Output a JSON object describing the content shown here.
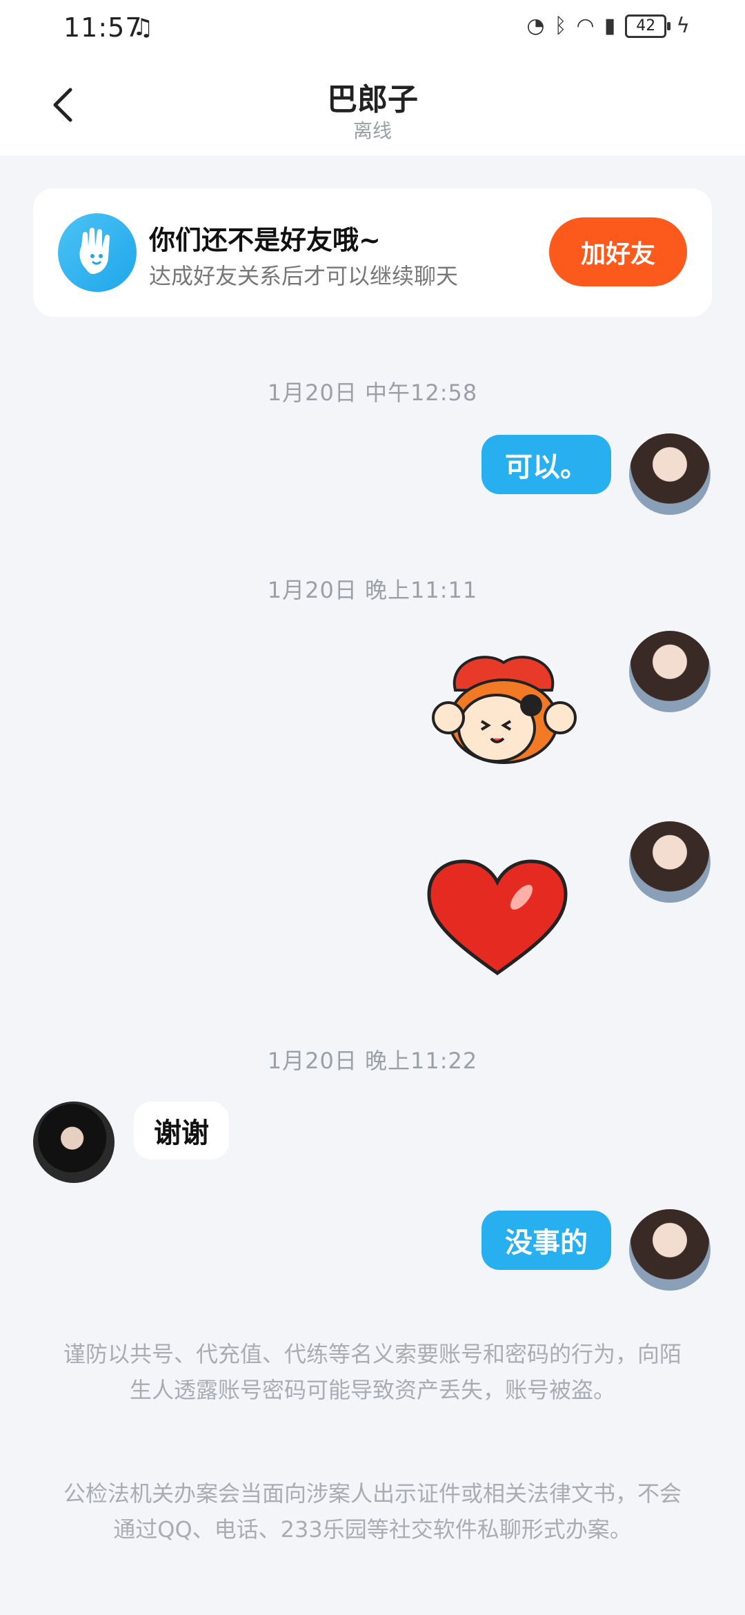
{
  "status_bar": {
    "time": "11:57",
    "icons": [
      "speed-icon",
      "bluetooth-icon",
      "wifi-icon",
      "alert-icon",
      "charging-icon"
    ],
    "battery": "42"
  },
  "header": {
    "title": "巴郎子",
    "status": "离线"
  },
  "friend_card": {
    "title": "你们还不是好友哦~",
    "subtitle": "达成好友关系后才可以继续聊天",
    "button": "加好友"
  },
  "messages": [
    {
      "type": "timestamp",
      "text": "1月20日 中午12:58"
    },
    {
      "type": "text",
      "side": "me",
      "text": "可以。"
    },
    {
      "type": "timestamp",
      "text": "1月20日 晚上11:11"
    },
    {
      "type": "sticker",
      "side": "me",
      "sticker": "cartoon-character-sticker"
    },
    {
      "type": "sticker",
      "side": "me",
      "sticker": "red-heart-sticker"
    },
    {
      "type": "timestamp",
      "text": "1月20日 晚上11:22"
    },
    {
      "type": "text",
      "side": "other",
      "text": "谢谢"
    },
    {
      "type": "text",
      "side": "me",
      "text": "没事的"
    }
  ],
  "notices": [
    "谨防以共号、代充值、代练等名义索要账号和密码的行为，向陌生人透露账号密码可能导致资产丢失，账号被盗。",
    "公检法机关办案会当面向涉案人出示证件或相关法律文书，不会通过QQ、电话、233乐园等社交软件私聊形式办案。"
  ],
  "colors": {
    "accent_blue": "#27aff0",
    "add_button": "#fb5a1c",
    "background": "#f3f5f8"
  }
}
